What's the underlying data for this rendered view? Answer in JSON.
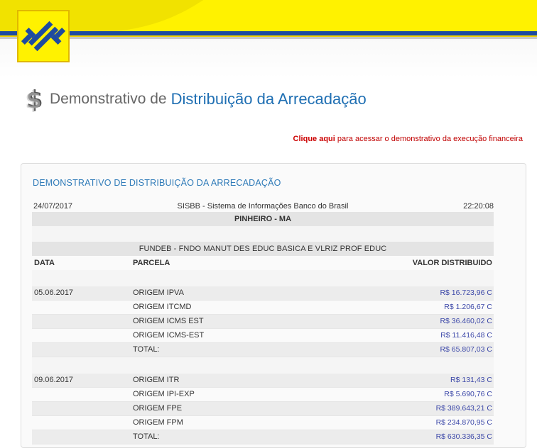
{
  "header": {
    "title_part1": "Demonstrativo de",
    "title_part2": "Distribuição da Arrecadação",
    "icons": {
      "logo": "banco-do-brasil-logo",
      "title_icon": "dollar-sign-icon"
    }
  },
  "link": {
    "bold": "Clique aqui",
    "rest": "para acessar o demonstrativo da execução financeira"
  },
  "card": {
    "title": "DEMONSTRATIVO DE DISTRIBUIÇÃO DA ARRECADAÇÃO",
    "date": "24/07/2017",
    "system": "SISBB - Sistema de Informações Banco do Brasil",
    "time": "22:20:08",
    "city": "PINHEIRO - MA",
    "fund": "FUNDEB - FNDO MANUT DES EDUC BASICA E VLRIZ PROF EDUC",
    "columns": {
      "date": "DATA",
      "parcel": "PARCELA",
      "value": "VALOR DISTRIBUIDO"
    },
    "groups": [
      {
        "date": "05.06.2017",
        "rows": [
          {
            "parcel": "ORIGEM IPVA",
            "value": "R$ 16.723,96 C"
          },
          {
            "parcel": "ORIGEM ITCMD",
            "value": "R$ 1.206,67 C"
          },
          {
            "parcel": "ORIGEM ICMS EST",
            "value": "R$ 36.460,02 C"
          },
          {
            "parcel": "ORIGEM ICMS-EST",
            "value": "R$ 11.416,48 C"
          },
          {
            "parcel": "TOTAL:",
            "value": "R$ 65.807,03 C"
          }
        ]
      },
      {
        "date": "09.06.2017",
        "rows": [
          {
            "parcel": "ORIGEM ITR",
            "value": "R$ 131,43 C"
          },
          {
            "parcel": "ORIGEM IPI-EXP",
            "value": "R$ 5.690,76 C"
          },
          {
            "parcel": "ORIGEM FPE",
            "value": "R$ 389.643,21 C"
          },
          {
            "parcel": "ORIGEM FPM",
            "value": "R$ 234.870,95 C"
          },
          {
            "parcel": "TOTAL:",
            "value": "R$ 630.336,35 C"
          }
        ]
      }
    ]
  },
  "colors": {
    "brand_yellow": "#fff200",
    "brand_blue": "#1e4ba0",
    "title_blue": "#1f6fb3",
    "link_red": "#cc0000",
    "value_blue": "#3b47a8"
  }
}
